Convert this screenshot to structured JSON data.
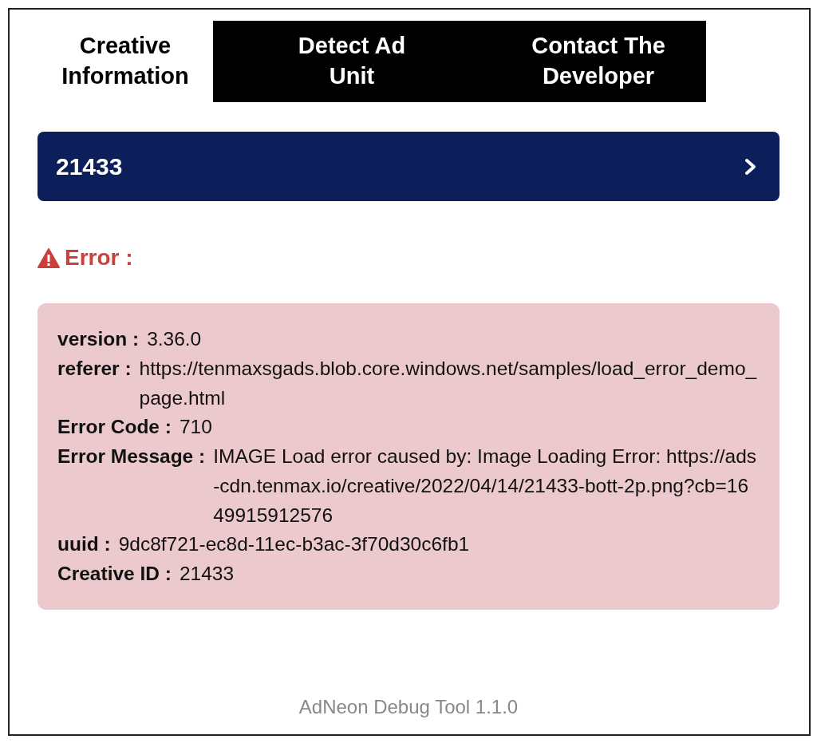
{
  "tabs": [
    {
      "label": "Creative Information",
      "selected": true
    },
    {
      "label": "Detect Ad Unit",
      "selected": false
    },
    {
      "label": "Contact The Developer",
      "selected": false
    }
  ],
  "accordion": {
    "title": "21433",
    "expanded": false
  },
  "error": {
    "heading": "Error :"
  },
  "details": [
    {
      "label": "version :",
      "value": "3.36.0"
    },
    {
      "label": "referer :",
      "value": "https://tenmaxsgads.blob.core.windows.net/samples/load_error_demo_page.html"
    },
    {
      "label": "Error Code :",
      "value": "710"
    },
    {
      "label": "Error Message :",
      "value": "IMAGE Load error caused by: Image Loading Error: https://ads-cdn.tenmax.io/creative/2022/04/14/21433-bott-2p.png?cb=1649915912576"
    },
    {
      "label": "uuid :",
      "value": "9dc8f721-ec8d-11ec-b3ac-3f70d30c6fb1"
    },
    {
      "label": "Creative ID :",
      "value": "21433"
    }
  ],
  "footer": "AdNeon Debug Tool 1.1.0"
}
